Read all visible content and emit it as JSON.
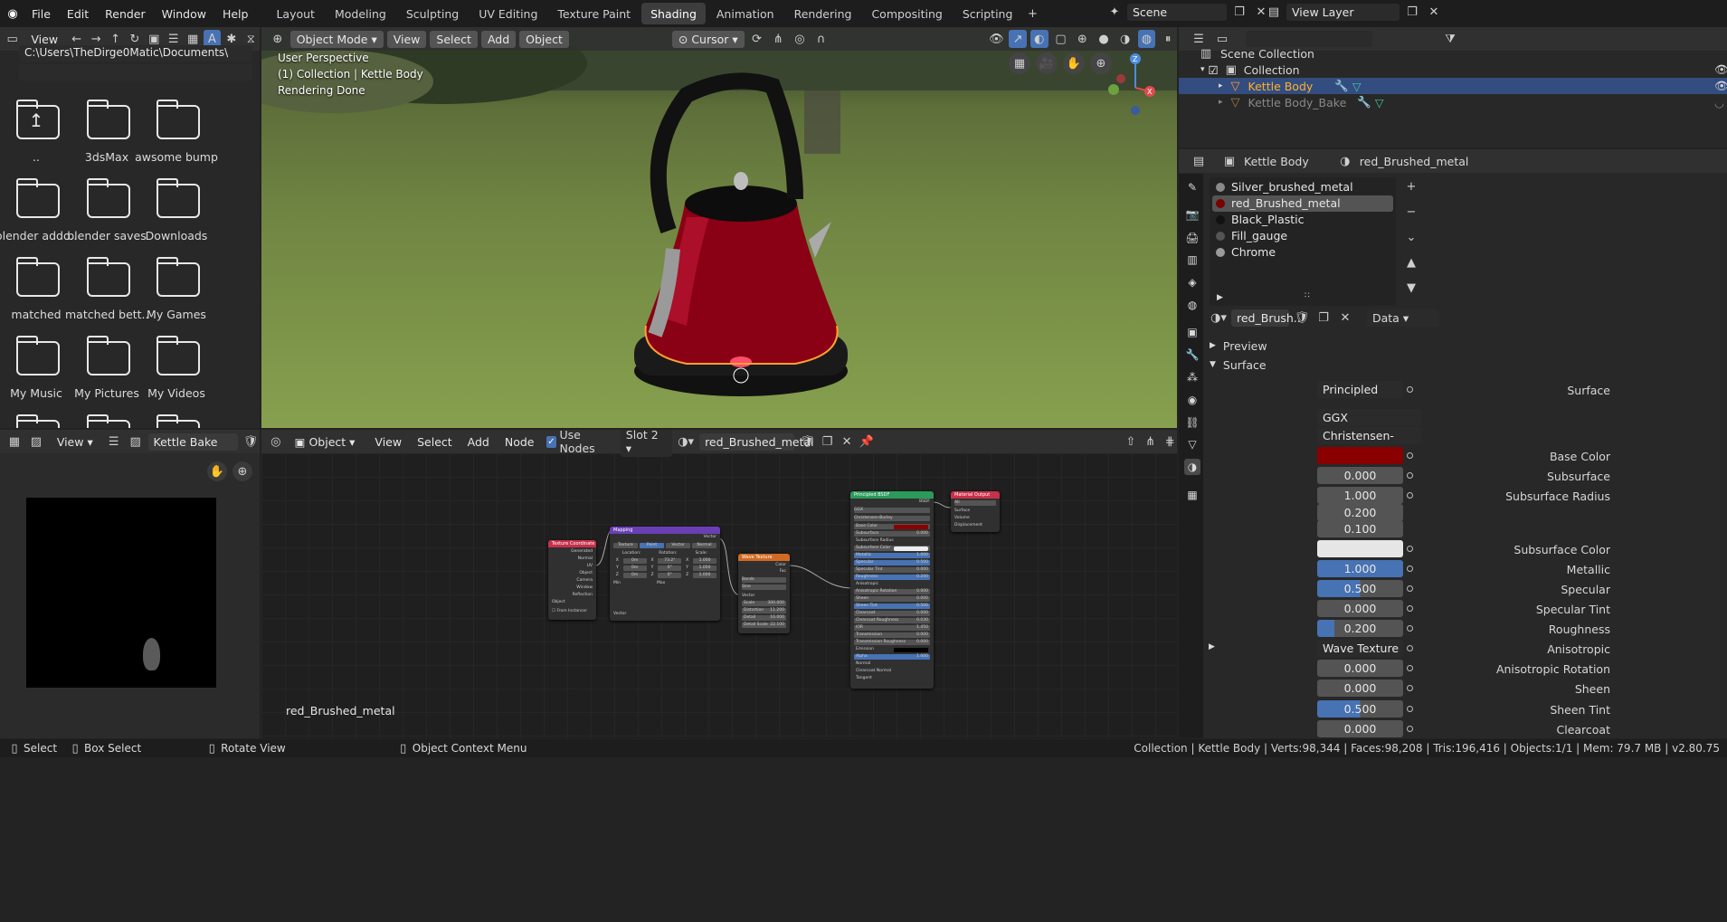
{
  "app_menu": [
    "File",
    "Edit",
    "Render",
    "Window",
    "Help"
  ],
  "workspaces": [
    "Layout",
    "Modeling",
    "Sculpting",
    "UV Editing",
    "Texture Paint",
    "Shading",
    "Animation",
    "Rendering",
    "Compositing",
    "Scripting"
  ],
  "active_workspace": "Shading",
  "scene": {
    "name": "Scene",
    "view_layer": "View Layer"
  },
  "file_browser": {
    "view_menu": "View",
    "path": "C:\\Users\\TheDirge0Matic\\Documents\\",
    "items": [
      {
        "label": "..",
        "type": "parent"
      },
      {
        "label": "3dsMax"
      },
      {
        "label": "awsome bump"
      },
      {
        "label": "blender addo.."
      },
      {
        "label": "blender saves"
      },
      {
        "label": "Downloads"
      },
      {
        "label": "matched"
      },
      {
        "label": "matched bett.."
      },
      {
        "label": "My Games"
      },
      {
        "label": "My Music"
      },
      {
        "label": "My Pictures"
      },
      {
        "label": "My Videos"
      }
    ]
  },
  "viewport": {
    "mode": "Object Mode",
    "menus": [
      "View",
      "Select",
      "Add",
      "Object"
    ],
    "snap": "Cursor",
    "overlay_lines": [
      "User Perspective",
      "(1) Collection | Kettle Body",
      "Rendering Done"
    ],
    "gizmo": {
      "z": "Z",
      "x": "X"
    }
  },
  "outliner": {
    "title": "Scene Collection",
    "items": [
      {
        "label": "Collection",
        "level": 1
      },
      {
        "label": "Kettle Body",
        "level": 2,
        "selected": true
      },
      {
        "label": "Kettle Body_Bake",
        "level": 2
      }
    ]
  },
  "properties": {
    "object": "Kettle Body",
    "material": "red_Brushed_metal",
    "slots": [
      "Silver_brushed_metal",
      "red_Brushed_metal",
      "Black_Plastic",
      "Fill_gauge",
      "Chrome"
    ],
    "active_slot": 1,
    "slot_colors": [
      "#8a8a8a",
      "#7a0000",
      "#111111",
      "#555555",
      "#9a9a9a"
    ],
    "material_field": "red_Brush..",
    "link": "Data",
    "panels": {
      "preview": "Preview",
      "surface": "Surface"
    },
    "rows": [
      {
        "label": "Surface",
        "value": "Principled BSDF"
      },
      {
        "label": "",
        "value": "GGX"
      },
      {
        "label": "",
        "value": "Christensen-Burley"
      },
      {
        "label": "Base Color",
        "value": "",
        "color": "#8a0000"
      },
      {
        "label": "Subsurface",
        "value": "0.000"
      },
      {
        "label": "Subsurface Radius",
        "value": "1.000"
      },
      {
        "label": "",
        "value": "0.200"
      },
      {
        "label": "",
        "value": "0.100"
      },
      {
        "label": "Subsurface Color",
        "value": "",
        "color": "#e6e6e6"
      },
      {
        "label": "Metallic",
        "value": "1.000",
        "fill": 1.0
      },
      {
        "label": "Specular",
        "value": "0.500",
        "fill": 0.5
      },
      {
        "label": "Specular Tint",
        "value": "0.000"
      },
      {
        "label": "Roughness",
        "value": "0.200",
        "fill": 0.2
      },
      {
        "label": "Anisotropic",
        "value": "Wave Texture"
      },
      {
        "label": "Anisotropic Rotation",
        "value": "0.000"
      },
      {
        "label": "Sheen",
        "value": "0.000"
      },
      {
        "label": "Sheen Tint",
        "value": "0.500",
        "fill": 0.5
      },
      {
        "label": "Clearcoat",
        "value": "0.000"
      }
    ]
  },
  "image_editor": {
    "view": "View",
    "image": "Kettle Bake"
  },
  "node_editor": {
    "editor_type": "Object",
    "menus": [
      "View",
      "Select",
      "Add",
      "Node"
    ],
    "use_nodes": "Use Nodes",
    "slot": "Slot 2",
    "material": "red_Brushed_metal",
    "footer_label": "red_Brushed_metal",
    "nodes": {
      "texcoord": {
        "title": "Texture Coordinate",
        "outputs": [
          "Generated",
          "Normal",
          "UV",
          "Object",
          "Camera",
          "Window",
          "Reflection"
        ],
        "object": "Object",
        "instancer": "From Instancer"
      },
      "mapping": {
        "title": "Mapping",
        "output": "Vector",
        "types": [
          "Texture",
          "Point",
          "Vector",
          "Normal"
        ],
        "cols": [
          "Location:",
          "Rotation:",
          "Scale:"
        ],
        "rows": [
          [
            "X",
            "0m",
            "X",
            "73.2°",
            "X",
            "1.000"
          ],
          [
            "Y",
            "0m",
            "Y",
            "0°",
            "Y",
            "1.000"
          ],
          [
            "Z",
            "0m",
            "Z",
            "0°",
            "Z",
            "1.000"
          ]
        ],
        "min": "Min",
        "max": "Max",
        "input": "Vector"
      },
      "wave": {
        "title": "Wave Texture",
        "outputs": [
          "Color",
          "Fac"
        ],
        "opts": [
          "Bands",
          "Sine"
        ],
        "input": "Vector",
        "fields": [
          [
            "Scale",
            "300.000"
          ],
          [
            "Distortion",
            "11.200"
          ],
          [
            "Detail",
            "16.000"
          ],
          [
            "Detail Scale",
            "22.100"
          ]
        ]
      },
      "bsdf": {
        "title": "Principled BSDF",
        "output": "BSDF",
        "opts": [
          "GGX",
          "Christensen-Burley"
        ],
        "fields": [
          [
            "Base Color",
            ""
          ],
          [
            "Subsurface",
            "0.000"
          ],
          [
            "Subsurface Radius",
            ""
          ],
          [
            "Subsurface Color",
            ""
          ],
          [
            "Metallic",
            "1.000"
          ],
          [
            "Specular",
            "0.500"
          ],
          [
            "Specular Tint",
            "0.000"
          ],
          [
            "Roughness",
            "0.200"
          ],
          [
            "Anisotropic",
            ""
          ],
          [
            "Anisotropic Rotation",
            "0.000"
          ],
          [
            "Sheen",
            "0.000"
          ],
          [
            "Sheen Tint",
            "0.500"
          ],
          [
            "Clearcoat",
            "0.000"
          ],
          [
            "Clearcoat Roughness",
            "0.030"
          ],
          [
            "IOR",
            "1.450"
          ],
          [
            "Transmission",
            "0.000"
          ],
          [
            "Transmission Roughness",
            "0.000"
          ],
          [
            "Emission",
            ""
          ],
          [
            "Alpha",
            "1.000"
          ],
          [
            "Normal",
            ""
          ],
          [
            "Clearcoat Normal",
            ""
          ],
          [
            "Tangent",
            ""
          ]
        ]
      },
      "output": {
        "title": "Material Output",
        "opt": "All",
        "inputs": [
          "Surface",
          "Volume",
          "Displacement"
        ]
      }
    }
  },
  "status_bar": {
    "select": "Select",
    "box_select": "Box Select",
    "rotate": "Rotate View",
    "context": "Object Context Menu",
    "stats": "Collection | Kettle Body | Verts:98,344 | Faces:98,208 | Tris:196,416 | Objects:1/1 | Mem: 79.7 MB | v2.80.75"
  }
}
